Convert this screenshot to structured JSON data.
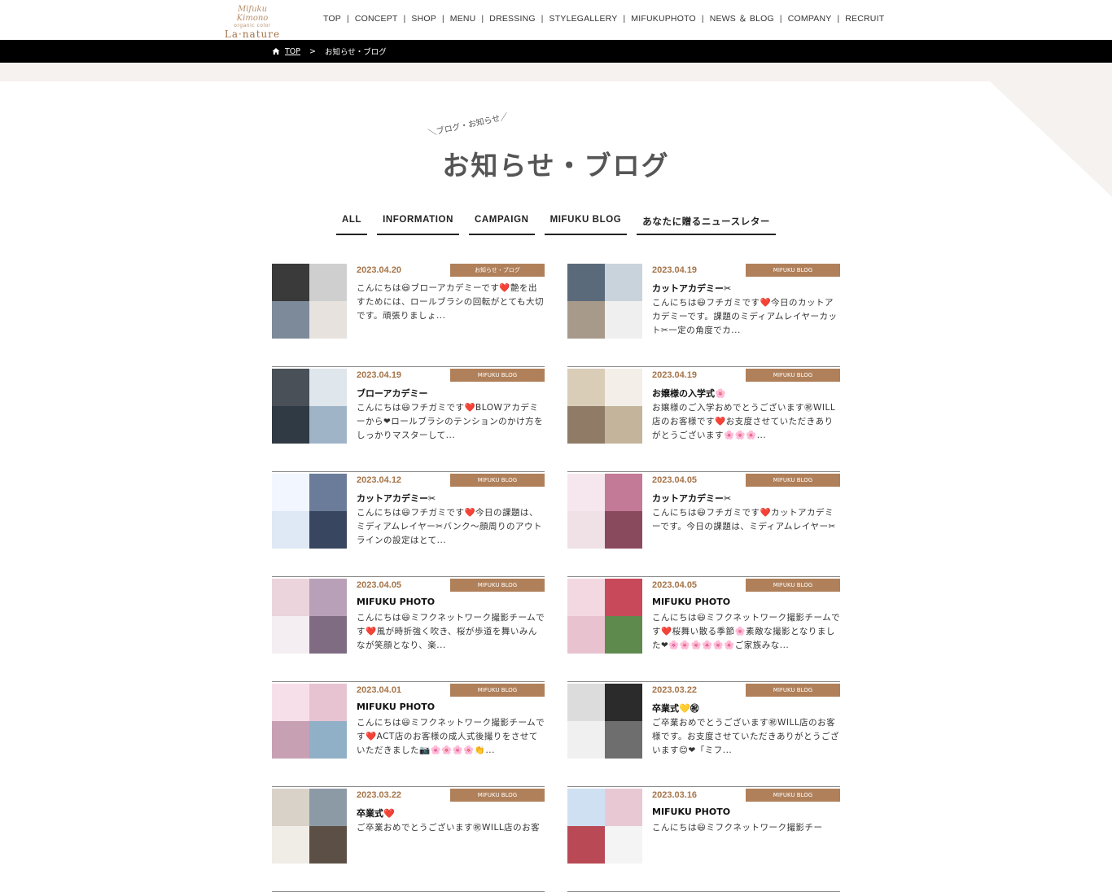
{
  "header": {
    "logo_script": "Mifuku Kimono",
    "logo_small": "organic color",
    "logo_main": "La·nature",
    "nav": [
      "TOP",
      "CONCEPT",
      "SHOP",
      "MENU",
      "DRESSING",
      "STYLEGALLERY",
      "MIFUKUPHOTO",
      "NEWS ＆ BLOG",
      "COMPANY",
      "RECRUIT"
    ]
  },
  "breadcrumb": {
    "home": "TOP",
    "separator": ">",
    "current": "お知らせ・ブログ",
    "home_icon": "home-icon"
  },
  "section": {
    "sub_label": "＼ブログ・お知らせ／",
    "title": "お知らせ・ブログ"
  },
  "tabs": [
    "ALL",
    "INFORMATION",
    "CAMPAIGN",
    "MIFUKU BLOG",
    "あなたに贈るニュースレター"
  ],
  "colors": {
    "accent": "#a6754a",
    "badge": "#b0805a",
    "breadcrumb_bg": "#000000",
    "band": "#f6f2ef"
  },
  "posts": [
    {
      "date": "2023.04.20",
      "category": "お知らせ・ブログ",
      "title": "",
      "excerpt": "こんにちは😃ブローアカデミーです❤️艶を出すためには、ロールブラシの回転がとても大切です。頑張りましょ..."
    },
    {
      "date": "2023.04.19",
      "category": "MIFUKU BLOG",
      "title": "カットアカデミー✂",
      "excerpt": "こんにちは😃フチガミです❤️今日のカットアカデミーです。課題のミディアムレイヤーカット✂一定の角度でカ..."
    },
    {
      "date": "2023.04.19",
      "category": "MIFUKU BLOG",
      "title": "ブローアカデミー",
      "excerpt": "こんにちは😃フチガミです❤️BLOWアカデミーから❤ロールブラシのテンションのかけ方をしっかりマスターして..."
    },
    {
      "date": "2023.04.19",
      "category": "MIFUKU BLOG",
      "title": "お嬢様の入学式🌸",
      "excerpt": "お嬢様のご入学おめでとうございます㊗WILL店のお客様です❤️お支度させていただきありがとうございます🌸🌸🌸..."
    },
    {
      "date": "2023.04.12",
      "category": "MIFUKU BLOG",
      "title": "カットアカデミー✂",
      "excerpt": "こんにちは😃フチガミです❤️今日の課題は、ミディアムレイヤー✂バンク〜顔周りのアウトラインの設定はとて..."
    },
    {
      "date": "2023.04.05",
      "category": "MIFUKU BLOG",
      "title": "カットアカデミー✂",
      "excerpt": "こんにちは😃フチガミです❤️カットアカデミーです。今日の課題は、ミディアムレイヤー✂"
    },
    {
      "date": "2023.04.05",
      "category": "MIFUKU BLOG",
      "title": "MIFUKU PHOTO",
      "excerpt": "こんにちは😃ミフクネットワーク撮影チームです❤️風が時折強く吹き、桜が歩道を舞いみんなが笑顔となり、楽..."
    },
    {
      "date": "2023.04.05",
      "category": "MIFUKU BLOG",
      "title": "MIFUKU PHOTO",
      "excerpt": "こんにちは😃ミフクネットワーク撮影チームです❤️桜舞い散る季節🌸素敵な撮影となりました❤🌸🌸🌸🌸🌸🌸ご家族みな..."
    },
    {
      "date": "2023.04.01",
      "category": "MIFUKU BLOG",
      "title": "MIFUKU PHOTO",
      "excerpt": "こんにちは😃ミフクネットワーク撮影チームです❤️ACT店のお客様の成人式後撮りをさせていただきました📷🌸🌸🌸🌸👏..."
    },
    {
      "date": "2023.03.22",
      "category": "MIFUKU BLOG",
      "title": "卒業式💛㊗",
      "excerpt": "ご卒業おめでとうございます㊗WILL店のお客様です。お支度させていただきありがとうございます😊❤「ミフ..."
    },
    {
      "date": "2023.03.22",
      "category": "MIFUKU BLOG",
      "title": "卒業式❤️",
      "excerpt": "ご卒業おめでとうございます㊗WILL店のお客"
    },
    {
      "date": "2023.03.16",
      "category": "MIFUKU BLOG",
      "title": "MIFUKU PHOTO",
      "excerpt": "こんにちは😃ミフクネットワーク撮影チー"
    }
  ]
}
